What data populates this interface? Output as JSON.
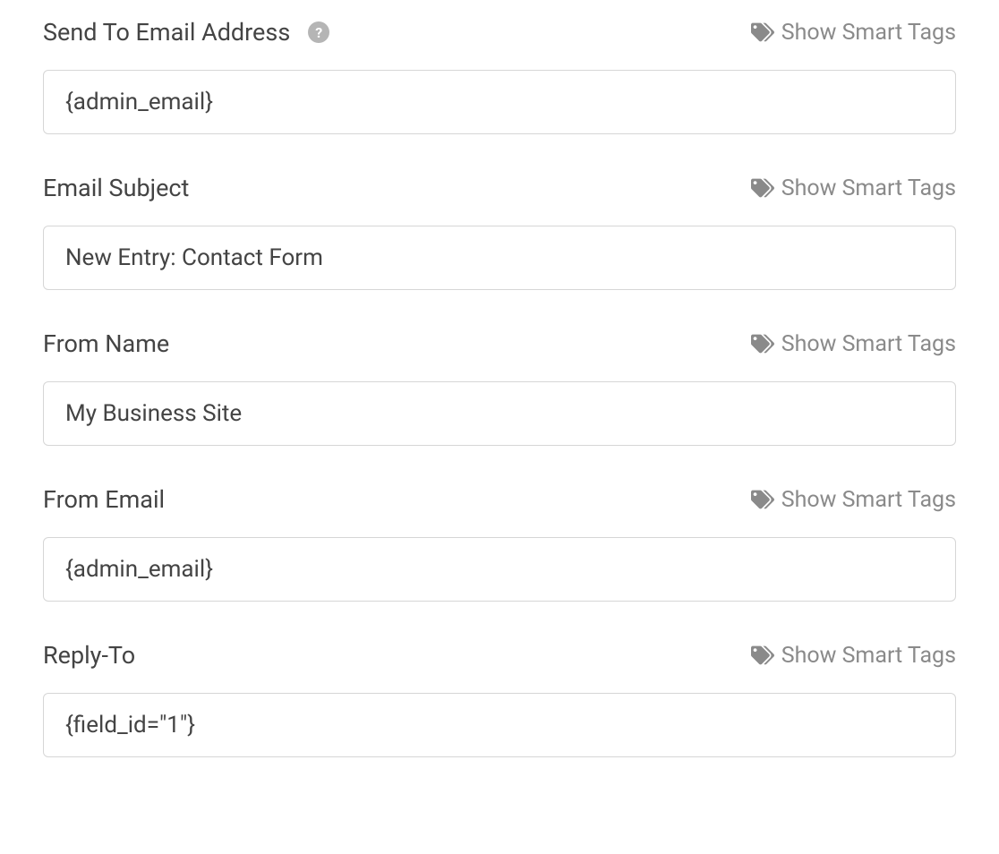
{
  "smart_tags_label": "Show Smart Tags",
  "fields": {
    "send_to": {
      "label": "Send To Email Address",
      "value": "{admin_email}",
      "has_help": true
    },
    "subject": {
      "label": "Email Subject",
      "value": "New Entry: Contact Form",
      "has_help": false
    },
    "from_name": {
      "label": "From Name",
      "value": "My Business Site",
      "has_help": false
    },
    "from_email": {
      "label": "From Email",
      "value": "{admin_email}",
      "has_help": false
    },
    "reply_to": {
      "label": "Reply-To",
      "value": "{field_id=\"1\"}",
      "has_help": false
    }
  }
}
